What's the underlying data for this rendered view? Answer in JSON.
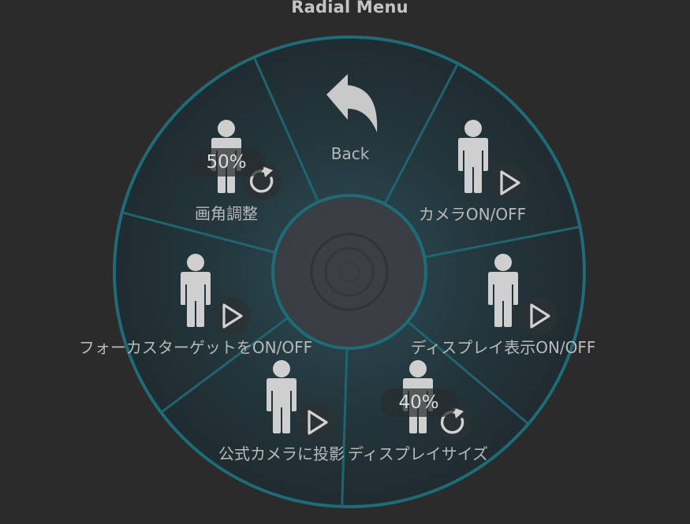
{
  "header": {
    "title": "Radial Menu"
  },
  "menu": {
    "back": {
      "label": "Back",
      "icon": "back-arrow-icon"
    },
    "items": [
      {
        "id": "camera",
        "label": "カメラON/OFF",
        "action_icon": "play-icon"
      },
      {
        "id": "display",
        "label": "ディスプレイ表示ON/OFF",
        "action_icon": "play-icon"
      },
      {
        "id": "display-size",
        "label": "ディスプレイサイズ",
        "value": "40%",
        "action_icon": "reset-icon"
      },
      {
        "id": "official-camera",
        "label": "公式カメラに投影",
        "action_icon": "play-icon"
      },
      {
        "id": "focus-target",
        "label": "フォーカスターゲットをON/OFF",
        "action_icon": "play-icon"
      },
      {
        "id": "fov",
        "label": "画角調整",
        "value": "50%",
        "action_icon": "reset-icon"
      }
    ]
  },
  "colors": {
    "background": "#2b2b2b",
    "ring_fill": "#23343a",
    "ring_stroke": "#1f6b77",
    "center_fill": "#3a3f44",
    "icon_fill": "#cfcfcf",
    "text": "#b9b9b9"
  }
}
